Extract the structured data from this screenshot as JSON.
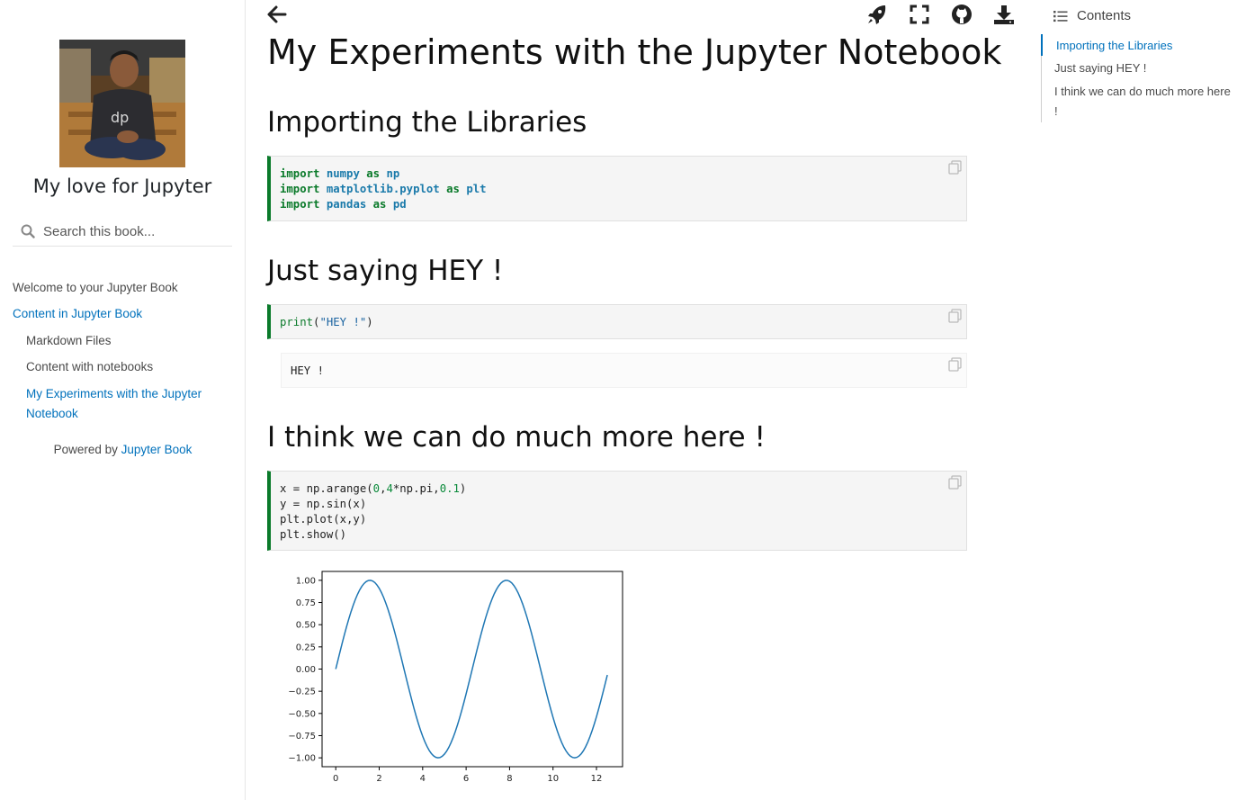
{
  "sidebar": {
    "book_title": "My love for Jupyter",
    "search_placeholder": "Search this book...",
    "nav": [
      {
        "label": "Welcome to your Jupyter Book",
        "active": false
      },
      {
        "label": "Content in Jupyter Book",
        "active": true
      },
      {
        "label": "Markdown Files",
        "active": false
      },
      {
        "label": "Content with notebooks",
        "active": false
      },
      {
        "label": "My Experiments with the Jupyter Notebook",
        "active": true
      }
    ],
    "powered_prefix": "Powered by",
    "powered_link": "Jupyter Book"
  },
  "toolbar": {
    "icons": [
      "back-arrow-icon",
      "rocket-icon",
      "fullscreen-icon",
      "github-icon",
      "download-icon"
    ]
  },
  "main": {
    "title": "My Experiments with the Jupyter Notebook",
    "sections": [
      {
        "heading": "Importing the Libraries"
      },
      {
        "heading": "Just saying HEY !"
      },
      {
        "heading": "I think we can do much more here !"
      }
    ],
    "cells": {
      "imports": [
        {
          "kw": "import",
          "mod": "numpy",
          "as": "as",
          "alias": "np"
        },
        {
          "kw": "import",
          "mod": "matplotlib.pyplot",
          "as": "as",
          "alias": "plt"
        },
        {
          "kw": "import",
          "mod": "pandas",
          "as": "as",
          "alias": "pd"
        }
      ],
      "hey_fn": "print",
      "hey_open": "(",
      "hey_str": "\"HEY !\"",
      "hey_close": ")",
      "hey_output": "HEY !",
      "plot_lines": {
        "l1_a": "x = np.arange(",
        "l1_n1": "0",
        "l1_c1": ",",
        "l1_n2": "4",
        "l1_b": "*np.pi,",
        "l1_n3": "0.1",
        "l1_c": ")",
        "l2": "y = np.sin(x)",
        "l3": "plt.plot(x,y)",
        "l4": "plt.show()"
      }
    }
  },
  "toc": {
    "header": "Contents",
    "items": [
      {
        "label": "Importing the Libraries",
        "active": true
      },
      {
        "label": "Just saying HEY !",
        "active": false
      },
      {
        "label": "I think we can do much more here !",
        "active": false
      }
    ]
  },
  "colors": {
    "accent": "#0071bc",
    "code_border": "#0a7a2a",
    "line": "#1f77b4"
  },
  "chart_data": {
    "type": "line",
    "title": "",
    "xlabel": "",
    "ylabel": "",
    "xlim": [
      -0.63,
      13.2
    ],
    "ylim": [
      -1.1,
      1.1
    ],
    "xticks": [
      "0",
      "2",
      "4",
      "6",
      "8",
      "10",
      "12"
    ],
    "xtick_values": [
      0,
      2,
      4,
      6,
      8,
      10,
      12
    ],
    "yticks": [
      "1.00",
      "0.75",
      "0.50",
      "0.25",
      "0.00",
      "−0.25",
      "−0.50",
      "−0.75",
      "−1.00"
    ],
    "ytick_values": [
      1.0,
      0.75,
      0.5,
      0.25,
      0.0,
      -0.25,
      -0.5,
      -0.75,
      -1.0
    ],
    "series": [
      {
        "function": "sin(x)",
        "x_start": 0,
        "x_end": 12.5,
        "x_step": 0.1
      }
    ]
  }
}
